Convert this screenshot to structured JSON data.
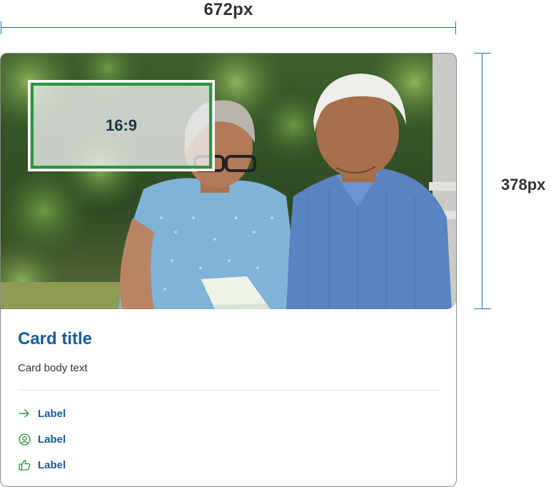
{
  "dimensions": {
    "width_label": "672px",
    "height_label": "378px"
  },
  "image": {
    "ratio_label": "16:9"
  },
  "card": {
    "title": "Card title",
    "body": "Card body text",
    "links": [
      {
        "icon": "arrow-right-icon",
        "label": "Label"
      },
      {
        "icon": "user-circle-icon",
        "label": "Label"
      },
      {
        "icon": "thumbs-up-icon",
        "label": "Label"
      }
    ]
  },
  "colors": {
    "accent_blue": "#1a5b9c",
    "annotation_blue": "#1f6fb2",
    "icon_green": "#2e9440",
    "border_gray": "#8a8a8a"
  }
}
